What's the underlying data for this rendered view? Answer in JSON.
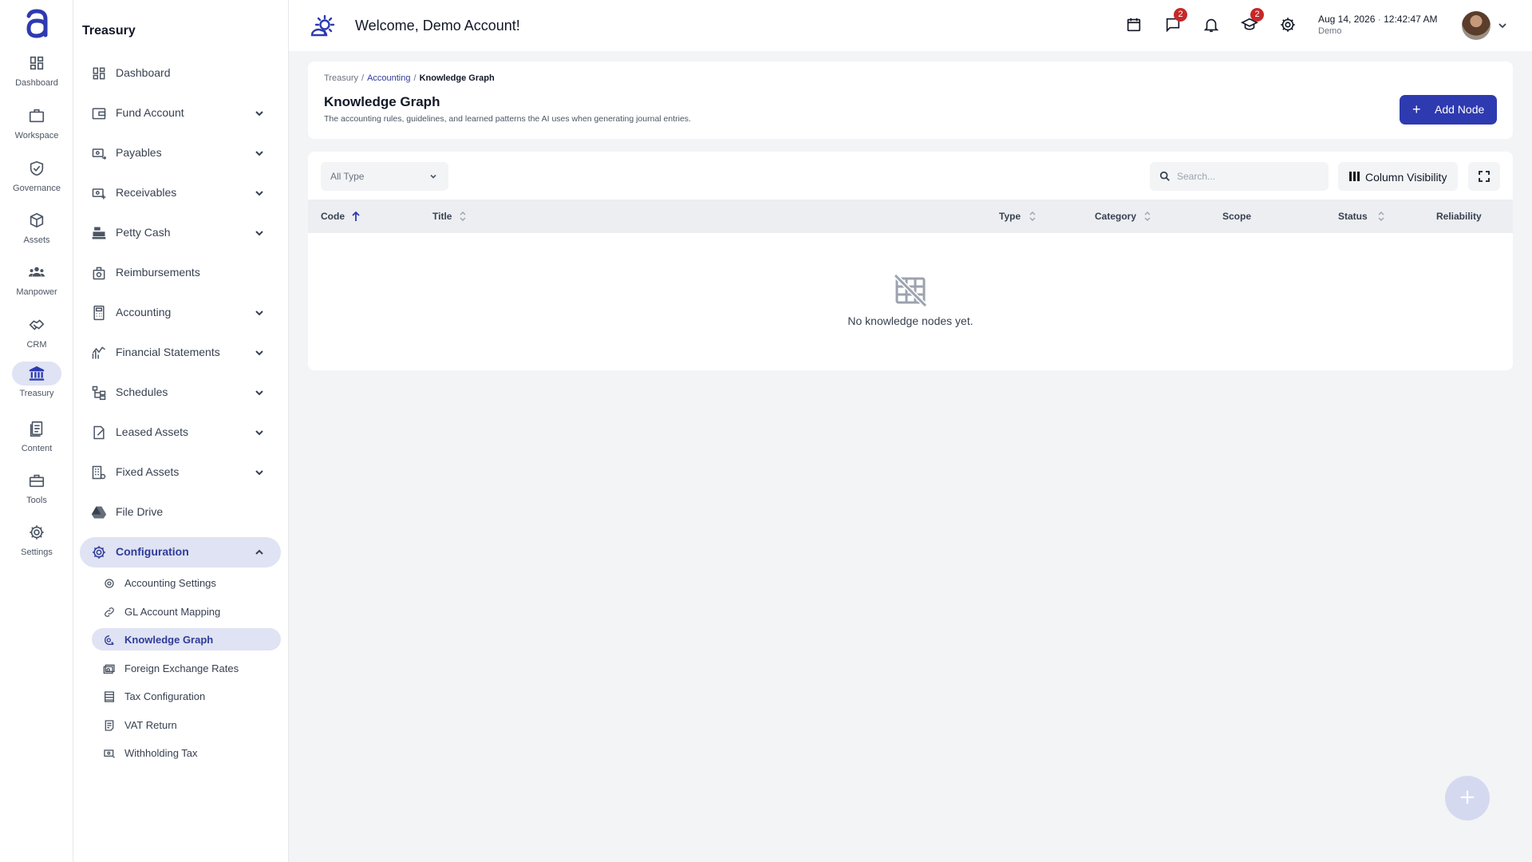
{
  "header": {
    "welcome": "Welcome, Demo Account!",
    "date": "Aug 14, 2026",
    "time": "12:42:47 AM",
    "role": "Demo",
    "icons": [
      "calendar-icon",
      "chat-icon",
      "bell-icon",
      "graduation-cap-icon",
      "gear-icon"
    ],
    "chat_badge": "2",
    "learning_badge": "2"
  },
  "rail": {
    "items": [
      {
        "label": "Dashboard",
        "icon": "dashboard-icon"
      },
      {
        "label": "Workspace",
        "icon": "briefcase-icon"
      },
      {
        "label": "Governance",
        "icon": "shield-check-icon"
      },
      {
        "label": "Assets",
        "icon": "cube-icon"
      },
      {
        "label": "Manpower",
        "icon": "people-icon"
      },
      {
        "label": "CRM",
        "icon": "handshake-icon"
      },
      {
        "label": "Treasury",
        "icon": "bank-icon",
        "active": true
      },
      {
        "label": "Content",
        "icon": "document-icon"
      },
      {
        "label": "Tools",
        "icon": "toolbox-icon"
      },
      {
        "label": "Settings",
        "icon": "gear-icon"
      }
    ]
  },
  "sidebar": {
    "title": "Treasury",
    "items": [
      {
        "label": "Dashboard",
        "icon": "dashboard-icon"
      },
      {
        "label": "Fund Account",
        "icon": "wallet-icon",
        "expandable": true
      },
      {
        "label": "Payables",
        "icon": "payment-out-icon",
        "expandable": true
      },
      {
        "label": "Receivables",
        "icon": "payment-in-icon",
        "expandable": true
      },
      {
        "label": "Petty Cash",
        "icon": "cash-register-icon",
        "expandable": true
      },
      {
        "label": "Reimbursements",
        "icon": "reimburse-icon"
      },
      {
        "label": "Accounting",
        "icon": "calculator-icon",
        "expandable": true
      },
      {
        "label": "Financial Statements",
        "icon": "chart-icon",
        "expandable": true
      },
      {
        "label": "Schedules",
        "icon": "schedule-tree-icon",
        "expandable": true
      },
      {
        "label": "Leased Assets",
        "icon": "lease-icon",
        "expandable": true
      },
      {
        "label": "Fixed Assets",
        "icon": "building-icon",
        "expandable": true
      },
      {
        "label": "File Drive",
        "icon": "drive-icon"
      },
      {
        "label": "Configuration",
        "icon": "gear-icon",
        "expanded": true
      }
    ],
    "sub_items": [
      {
        "label": "Accounting Settings",
        "icon": "gear-icon"
      },
      {
        "label": "GL Account Mapping",
        "icon": "link-icon"
      },
      {
        "label": "Knowledge Graph",
        "icon": "brain-icon",
        "active": true
      },
      {
        "label": "Foreign Exchange Rates",
        "icon": "currency-exchange-icon"
      },
      {
        "label": "Tax Configuration",
        "icon": "table-icon"
      },
      {
        "label": "VAT Return",
        "icon": "receipt-icon"
      },
      {
        "label": "Withholding Tax",
        "icon": "payment-icon"
      }
    ]
  },
  "breadcrumb": [
    "Treasury",
    "Accounting",
    "Knowledge Graph"
  ],
  "page": {
    "title": "Knowledge Graph",
    "description": "The accounting rules, guidelines, and learned patterns the AI uses when generating journal entries.",
    "add_button": "Add Node"
  },
  "toolbar": {
    "type_filter": "All Type",
    "search_placeholder": "Search...",
    "column_visibility": "Column Visibility"
  },
  "table": {
    "columns": [
      "Code",
      "Title",
      "Type",
      "Category",
      "Scope",
      "Status",
      "Reliability"
    ],
    "sort_column": "Code",
    "sort_direction": "ascending",
    "rows": [],
    "empty_message": "No knowledge nodes yet."
  },
  "colors": {
    "accent": "#2e3ab0",
    "active_bg": "#dfe3f3",
    "badge": "#c62828"
  }
}
